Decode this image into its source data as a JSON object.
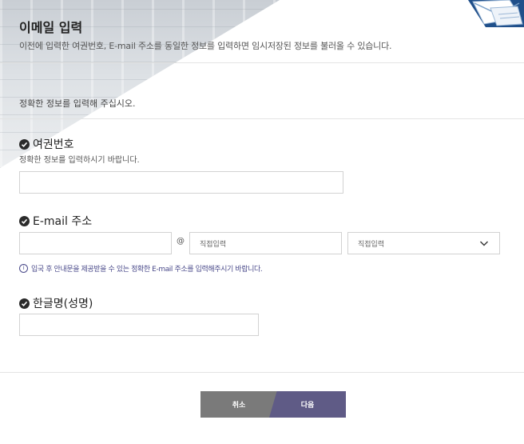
{
  "header": {
    "title": "이메일 입력",
    "subtitle": "이전에 입력한 여권번호, E-mail 주소를 동일한 정보를 입력하면 임시저장된 정보를 불러올 수 있습니다."
  },
  "notice": "정확한 정보를 입력해 주십시오.",
  "passport": {
    "label": "여권번호",
    "help": "정확한 정보를 입력하시기 바랍니다.",
    "value": ""
  },
  "email": {
    "label": "E-mail 주소",
    "local_value": "",
    "at": "@",
    "domain_placeholder": "직접입력",
    "domain_select_value": "직접입력",
    "info": "입국 후 안내문을 제공받을 수 있는 정확한 E-mail 주소를 입력해주시기 바랍니다."
  },
  "name": {
    "label": "한글명(성명)",
    "value": ""
  },
  "buttons": {
    "cancel": "취소",
    "next": "다음"
  },
  "colors": {
    "cancel_button": "#7a7a7a",
    "next_button": "#5f5b86",
    "info_text": "#4a4a8a"
  },
  "icons": [
    "check-circle-icon",
    "chevron-down-icon",
    "info-circle-icon",
    "envelope-icon"
  ]
}
